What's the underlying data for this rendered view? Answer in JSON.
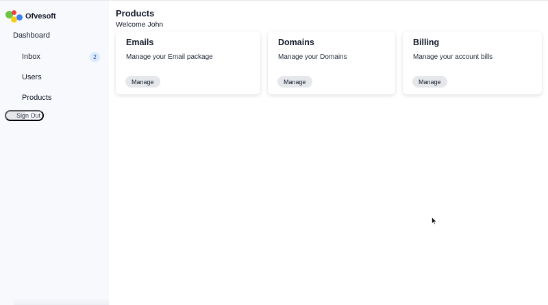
{
  "brand": {
    "name": "Ofvesoft"
  },
  "sidebar": {
    "dashboard_label": "Dashboard",
    "items": [
      {
        "label": "Inbox",
        "badge": "2"
      },
      {
        "label": "Users"
      },
      {
        "label": "Products"
      }
    ],
    "signout_label": "Sign Out"
  },
  "main": {
    "title": "Products",
    "welcome": "Welcome John",
    "cards": [
      {
        "title": "Emails",
        "description": "Manage your Email package",
        "button": "Manage"
      },
      {
        "title": "Domains",
        "description": "Manage your Domains",
        "button": "Manage"
      },
      {
        "title": "Billing",
        "description": "Manage your account bills",
        "button": "Manage"
      }
    ]
  },
  "colors": {
    "sidebar_bg": "#f8f9fc",
    "badge_bg": "#dbeafe",
    "button_bg": "#e5e7eb",
    "logo_green": "#6cc644",
    "logo_red": "#ef4444",
    "logo_blue": "#3b82f6",
    "logo_yellow": "#facc15"
  },
  "icons": {
    "logo": "ofvesoft-logo-icon",
    "cursor": "mouse-pointer-icon"
  }
}
